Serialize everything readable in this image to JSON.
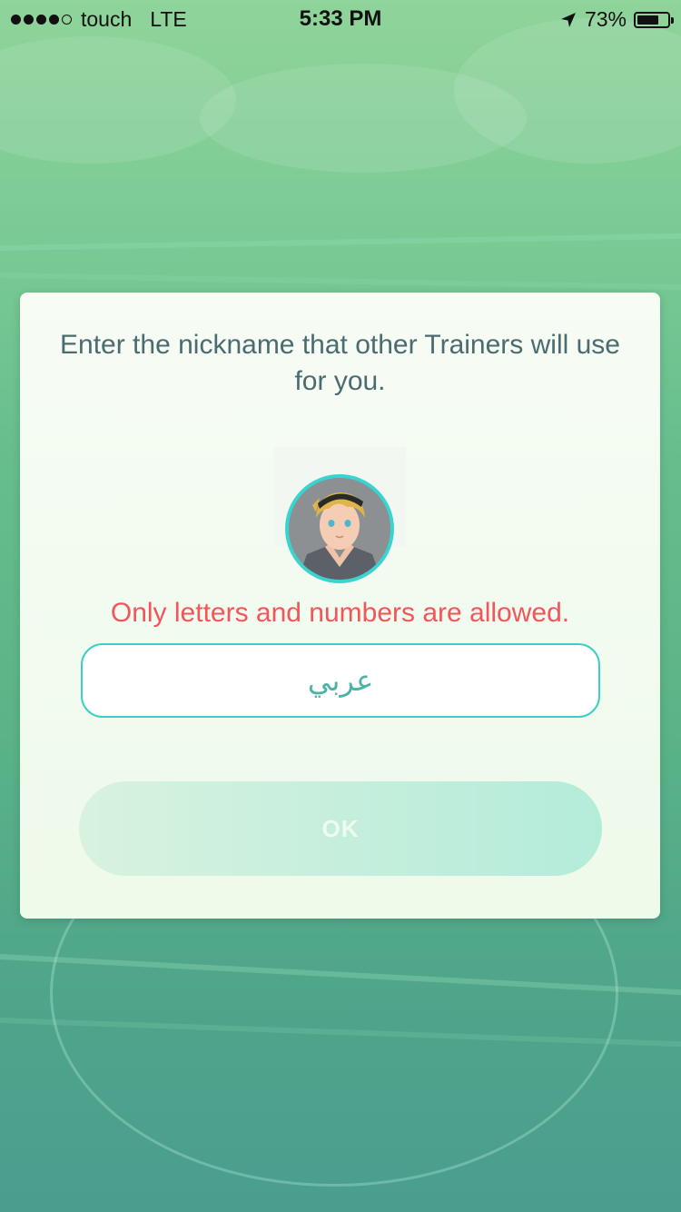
{
  "status_bar": {
    "signal_dots_filled": 4,
    "signal_dots_total": 5,
    "carrier": "touch",
    "network": "LTE",
    "time": "5:33 PM",
    "battery_text": "73%",
    "battery_level": 0.73
  },
  "dialog": {
    "prompt": "Enter the nickname that other Trainers will use for you.",
    "avatar_icon": "trainer-avatar",
    "error_message": "Only letters and numbers are allowed.",
    "nickname_value": "عربي",
    "ok_label": "OK"
  },
  "colors": {
    "error": "#f0565a",
    "input_border": "#3ccfc6",
    "prompt_text": "#4a6b70",
    "avatar_ring": "#38d4d0"
  }
}
